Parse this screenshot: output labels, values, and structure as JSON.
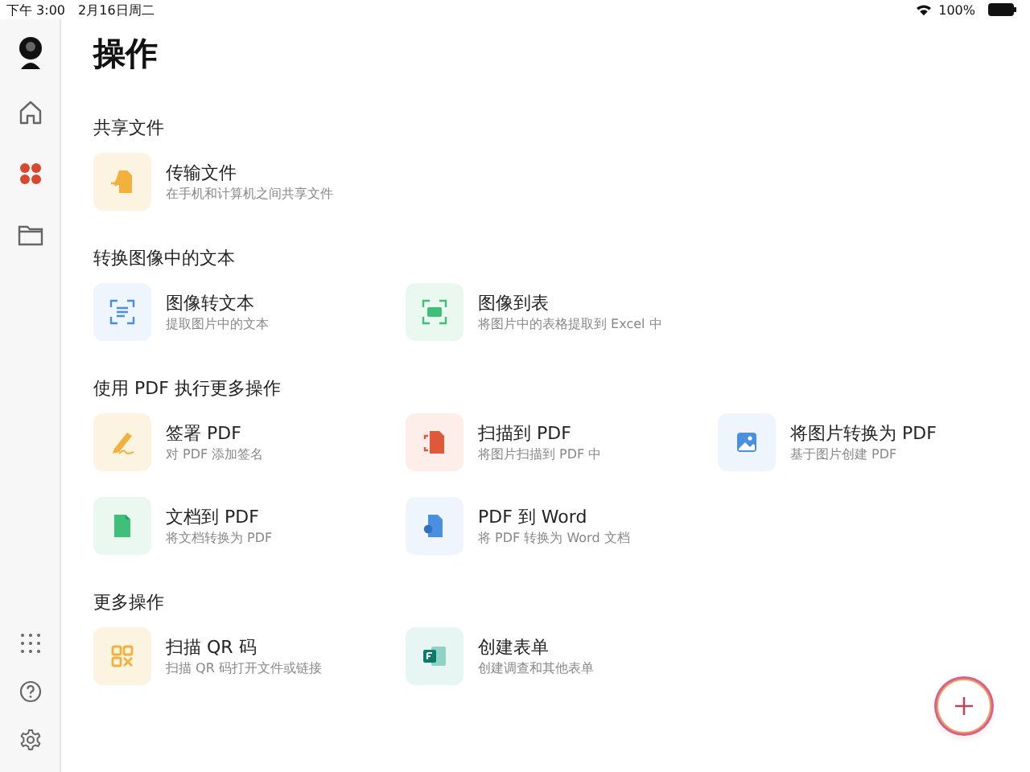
{
  "status_bar": {
    "time": "下午 3:00",
    "date": "2月16日周二",
    "battery": "100%"
  },
  "sidebar": {
    "top": [
      {
        "kind": "home",
        "selected": false
      },
      {
        "kind": "apps",
        "selected": true
      },
      {
        "kind": "folder",
        "selected": false
      }
    ],
    "bottom": [
      {
        "kind": "grid"
      },
      {
        "kind": "help"
      },
      {
        "kind": "settings"
      }
    ]
  },
  "title": "操作",
  "sections": [
    {
      "heading": "共享文件",
      "actions": [
        {
          "kind": "transfer",
          "title": "传输文件",
          "subtitle": "在手机和计算机之间共享文件"
        }
      ]
    },
    {
      "heading": "转换图像中的文本",
      "actions": [
        {
          "kind": "ocr",
          "title": "图像转文本",
          "subtitle": "提取图片中的文本"
        },
        {
          "kind": "table",
          "title": "图像到表",
          "subtitle": "将图片中的表格提取到 Excel 中"
        }
      ]
    },
    {
      "heading": "使用 PDF 执行更多操作",
      "actions": [
        {
          "kind": "sign",
          "title": "签署 PDF",
          "subtitle": "对 PDF 添加签名"
        },
        {
          "kind": "scan",
          "title": "扫描到 PDF",
          "subtitle": "将图片扫描到 PDF 中"
        },
        {
          "kind": "image",
          "title": "将图片转换为 PDF",
          "subtitle": "基于图片创建 PDF"
        },
        {
          "kind": "document",
          "title": "文档到 PDF",
          "subtitle": "将文档转换为 PDF"
        },
        {
          "kind": "word",
          "title": "PDF 到 Word",
          "subtitle": "将 PDF 转换为 Word 文档"
        }
      ]
    },
    {
      "heading": "更多操作",
      "actions": [
        {
          "kind": "qr",
          "title": "扫描 QR 码",
          "subtitle": "扫描 QR 码打开文件或链接"
        },
        {
          "kind": "form",
          "title": "创建表单",
          "subtitle": "创建调查和其他表单"
        }
      ]
    }
  ]
}
